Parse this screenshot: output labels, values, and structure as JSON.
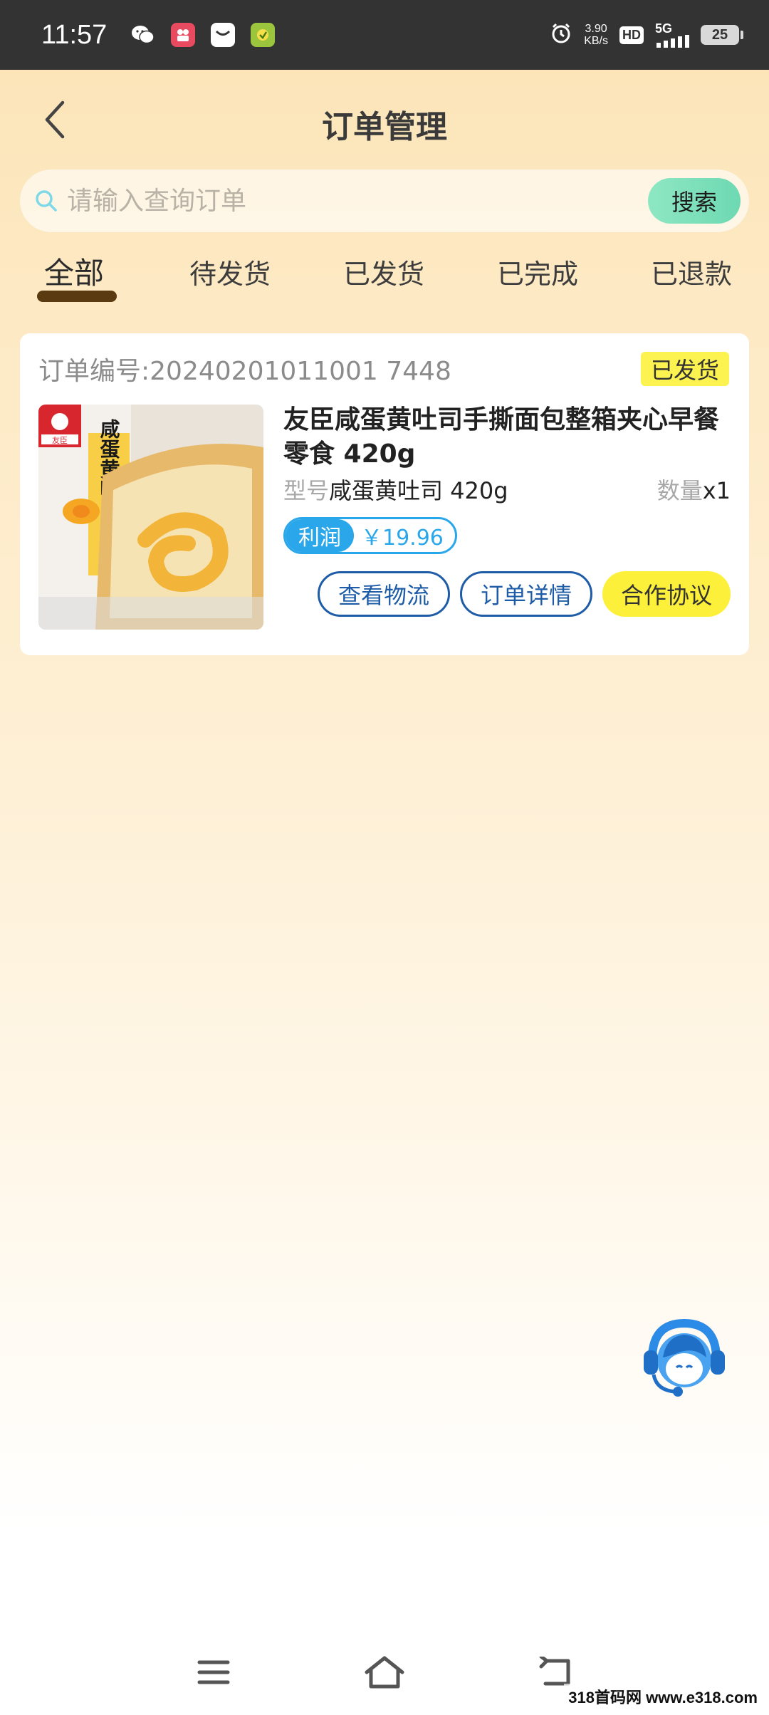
{
  "status_bar": {
    "time": "11:57",
    "net_speed_value": "3.90",
    "net_speed_unit": "KB/s",
    "hd": "HD",
    "signal": "5G",
    "battery": "25"
  },
  "header": {
    "title": "订单管理"
  },
  "search": {
    "placeholder": "请输入查询订单",
    "button_label": "搜索"
  },
  "tabs": [
    {
      "label": "全部",
      "active": true
    },
    {
      "label": "待发货",
      "active": false
    },
    {
      "label": "已发货",
      "active": false
    },
    {
      "label": "已完成",
      "active": false
    },
    {
      "label": "已退款",
      "active": false
    }
  ],
  "order": {
    "number_label": "订单编号:",
    "number": "20240201011001 7448",
    "status": "已发货",
    "product_title": "友臣咸蛋黄吐司手撕面包整箱夹心早餐零食 420g",
    "spec_label": "型号",
    "spec_value": "咸蛋黄吐司 420g",
    "qty_label": "数量",
    "qty_value": "x1",
    "profit_label": "利润",
    "profit_value": "￥19.96",
    "actions": {
      "logistics": "查看物流",
      "details": "订单详情",
      "agreement": "合作协议"
    },
    "image_text": {
      "brand": "友臣",
      "product": "咸蛋黄吐司"
    }
  },
  "watermark": "318首码网 www.e318.com",
  "colors": {
    "accent_blue": "#2aa6ea",
    "button_blue": "#1f5ca8",
    "badge_yellow": "#fdf350",
    "search_green": "#7ee0ba",
    "tab_indicator": "#5a3a10"
  },
  "icons": {
    "back": "chevron-left-icon",
    "search": "search-icon",
    "customer_service": "headset-icon",
    "nav_menu": "menu-icon",
    "nav_home": "home-icon",
    "nav_back": "back-icon"
  }
}
